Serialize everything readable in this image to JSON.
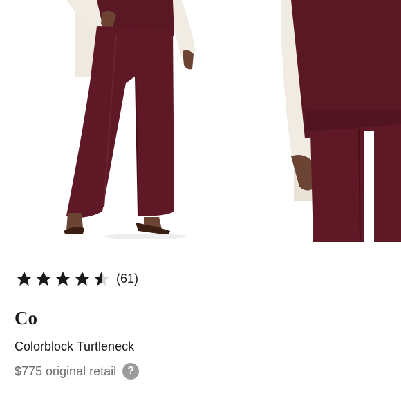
{
  "product": {
    "rating_value": 4.5,
    "rating_max": 5,
    "review_count": "(61)",
    "brand": "Co",
    "name": "Colorblock Turtleneck",
    "price": "$775 original retail",
    "help_glyph": "?"
  },
  "icons": {
    "star": "star-icon",
    "half_star": "star-half-icon",
    "help": "help-circle-icon"
  },
  "colors": {
    "burgundy": "#5e1826",
    "cream": "#f1ece3",
    "text": "#1a1a1a",
    "muted": "#6e6e6e",
    "help_bg": "#9b9b9b"
  }
}
